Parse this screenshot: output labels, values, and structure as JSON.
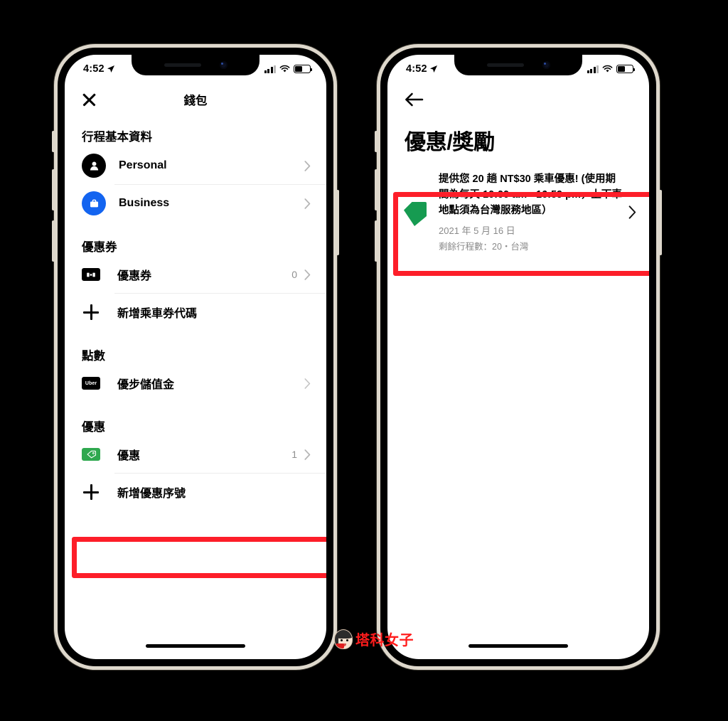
{
  "meta": {
    "watermark_text": "塔科女子"
  },
  "phones": [
    {
      "id": "wallet",
      "status_bar": {
        "time": "4:52",
        "location_icon": "location-arrow-icon",
        "battery_level": "50"
      },
      "header": {
        "close_icon": "close-icon",
        "title": "錢包"
      },
      "sections": [
        {
          "label": "行程基本資料",
          "rows": [
            {
              "icon": "person-avatar-icon",
              "label": "Personal",
              "value": "",
              "chevron": "chevron-right-icon"
            },
            {
              "icon": "briefcase-avatar-icon",
              "label": "Business",
              "value": "",
              "chevron": "chevron-right-icon"
            }
          ]
        },
        {
          "label": "優惠券",
          "rows": [
            {
              "icon": "ticket-icon",
              "label": "優惠券",
              "value": "0",
              "chevron": "chevron-right-icon"
            },
            {
              "icon": "plus-icon",
              "label": "新增乘車券代碼",
              "value": "",
              "chevron": ""
            }
          ]
        },
        {
          "label": "點數",
          "rows": [
            {
              "icon": "uber-cash-icon",
              "label": "優步儲值金",
              "value": "",
              "chevron": "chevron-right-icon"
            }
          ]
        },
        {
          "label": "優惠",
          "rows": [
            {
              "icon": "promo-tag-icon",
              "label": "優惠",
              "value": "1",
              "chevron": "chevron-right-icon",
              "highlighted": true
            },
            {
              "icon": "plus-icon",
              "label": "新增優惠序號",
              "value": "",
              "chevron": ""
            }
          ]
        }
      ]
    },
    {
      "id": "promotions",
      "status_bar": {
        "time": "4:52",
        "location_icon": "location-arrow-icon",
        "battery_level": "50"
      },
      "header": {
        "back_icon": "back-arrow-icon",
        "title": "優惠/獎勵"
      },
      "offer": {
        "tag_icon": "green-tag-icon",
        "title": "提供您 20 趟 NT$30 乘車優惠! (使用期間為每天 10:00 am - 16:59 pm，上下車地點須為台灣服務地區）",
        "date": "2021 年 5 月 16 日",
        "meta": "剩餘行程數：20・台灣",
        "chevron": "chevron-right-icon",
        "highlighted": true
      }
    }
  ],
  "colors": {
    "highlight_red": "#fd1e29",
    "promo_green": "#2fa84f",
    "business_blue": "#1364f0",
    "watermark_red": "#ff1c1c",
    "muted_gray": "#8a8a8a"
  }
}
